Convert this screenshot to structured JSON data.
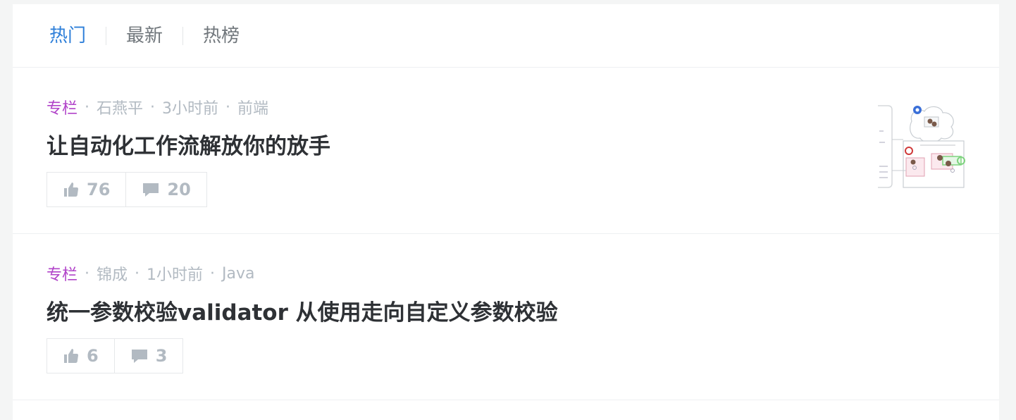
{
  "tabs": [
    {
      "label": "热门",
      "active": true
    },
    {
      "label": "最新",
      "active": false
    },
    {
      "label": "热榜",
      "active": false
    }
  ],
  "entries": [
    {
      "tag": "专栏",
      "author": "石燕平",
      "time": "3小时前",
      "category": "前端",
      "title": "让自动化工作流解放你的放手",
      "likes": "76",
      "comments": "20",
      "has_thumbnail": true
    },
    {
      "tag": "专栏",
      "author": "锦成",
      "time": "1小时前",
      "category": "Java",
      "title": "统一参数校验validator 从使用走向自定义参数校验",
      "likes": "6",
      "comments": "3",
      "has_thumbnail": false
    }
  ],
  "meta_separator": "·",
  "colors": {
    "active_tab": "#2e7fd9",
    "tag": "#b143c9",
    "muted": "#b2bac2",
    "title": "#2e3135"
  },
  "icons": {
    "like": "thumbs-up-icon",
    "comment": "comment-icon"
  }
}
